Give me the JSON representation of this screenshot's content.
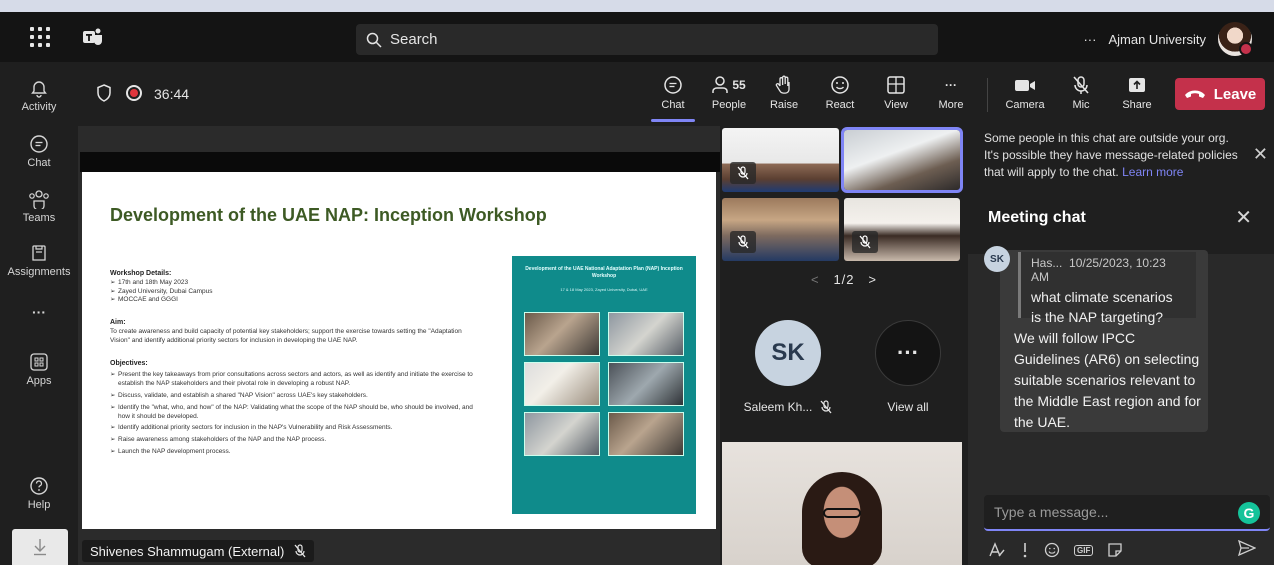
{
  "titlebar": {
    "search_placeholder": "Search",
    "more": "···",
    "org_name": "Ajman University"
  },
  "rail": {
    "items": [
      {
        "label": "Activity",
        "icon": "bell-icon"
      },
      {
        "label": "Chat",
        "icon": "chat-icon"
      },
      {
        "label": "Teams",
        "icon": "teams-icon"
      },
      {
        "label": "Assignments",
        "icon": "assignments-icon"
      },
      {
        "label": "···",
        "icon": "more-icon"
      },
      {
        "label": "Apps",
        "icon": "apps-icon"
      },
      {
        "label": "Help",
        "icon": "help-icon"
      }
    ]
  },
  "callbar": {
    "timer": "36:44",
    "chat": "Chat",
    "people": "People",
    "people_count": "55",
    "raise": "Raise",
    "react": "React",
    "view": "View",
    "more": "More",
    "camera": "Camera",
    "mic": "Mic",
    "share": "Share",
    "leave": "Leave",
    "more_glyph": "···"
  },
  "slide": {
    "title": "Development of the UAE NAP: Inception Workshop",
    "details_heading": "Workshop Details:",
    "details": [
      "17th and 18th May 2023",
      "Zayed University, Dubai Campus",
      "MOCCAE and GGGI"
    ],
    "aim_heading": "Aim:",
    "aim_text": "To create awareness and build capacity of potential key stakeholders; support the exercise towards setting the \"Adaptation Vision\" and identify additional priority sectors for inclusion in developing the UAE NAP.",
    "objectives_heading": "Objectives:",
    "objectives": [
      "Present the key takeaways from prior consultations across sectors and actors, as well as identify and initiate the exercise to establish the NAP stakeholders and their pivotal role in developing a robust NAP.",
      "Discuss, validate, and establish a shared \"NAP Vision\" across UAE's key stakeholders.",
      "Identify the \"what, who, and how\" of the NAP: Validating what the scope of the NAP should be, who should be involved, and how it should be developed.",
      "Identify additional priority sectors for inclusion in the NAP's Vulnerability and Risk Assessments.",
      "Raise awareness among stakeholders of the NAP and the NAP process.",
      "Launch the NAP development process."
    ],
    "poster_title": "Development of the UAE National Adaptation Plan (NAP) Inception Workshop",
    "poster_subtitle": "17 & 18 May 2023, Zayed University, Dubai, UAE",
    "presenter": "Shivenes Shammugam (External)"
  },
  "participants": {
    "pager": "1/2",
    "sk_initials": "SK",
    "sk_name": "Saleem Kh...",
    "view_all": "View all",
    "view_all_glyph": "···"
  },
  "chat": {
    "external_notice": "Some people in this chat are outside your org. It's possible they have message-related policies that will apply to the chat.",
    "learn_more": "Learn more",
    "title": "Meeting chat",
    "avatar": "SK",
    "quote_author": "Has...",
    "quote_time": "10/25/2023, 10:23 AM",
    "quote_text": "what climate scenarios is the NAP targeting?",
    "reply": "We will follow IPCC Guidelines (AR6) on selecting suitable scenarios relevant to the Middle East region and for the UAE.",
    "composer_placeholder": "Type a message...",
    "grammarly": "G",
    "gif": "GIF"
  },
  "colors": {
    "accent": "#7f85f5",
    "leave": "#c4314b",
    "slide_title": "#3d5a24",
    "poster": "#0f8b8b"
  }
}
